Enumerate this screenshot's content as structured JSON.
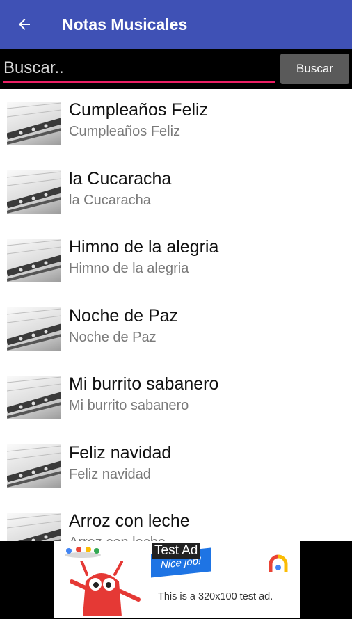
{
  "appbar": {
    "title": "Notas Musicales",
    "back_icon": "arrow-back-icon",
    "color": "#3f51b5"
  },
  "search": {
    "placeholder": "Buscar..",
    "button_label": "Buscar",
    "underline_color": "#e91e63"
  },
  "songs": [
    {
      "title": "Cumpleaños Feliz",
      "subtitle": "Cumpleaños Feliz"
    },
    {
      "title": "la Cucaracha",
      "subtitle": "la Cucaracha"
    },
    {
      "title": "Himno de la alegria",
      "subtitle": "Himno de la alegria"
    },
    {
      "title": "Noche de Paz",
      "subtitle": "Noche de Paz"
    },
    {
      "title": "Mi burrito sabanero",
      "subtitle": "Mi burrito sabanero"
    },
    {
      "title": "Feliz navidad",
      "subtitle": "Feliz navidad"
    },
    {
      "title": "Arroz con leche",
      "subtitle": "Arroz con leche"
    }
  ],
  "ad": {
    "label": "Test Ad",
    "banner": "Nice job!",
    "text": "This is a 320x100 test ad."
  }
}
